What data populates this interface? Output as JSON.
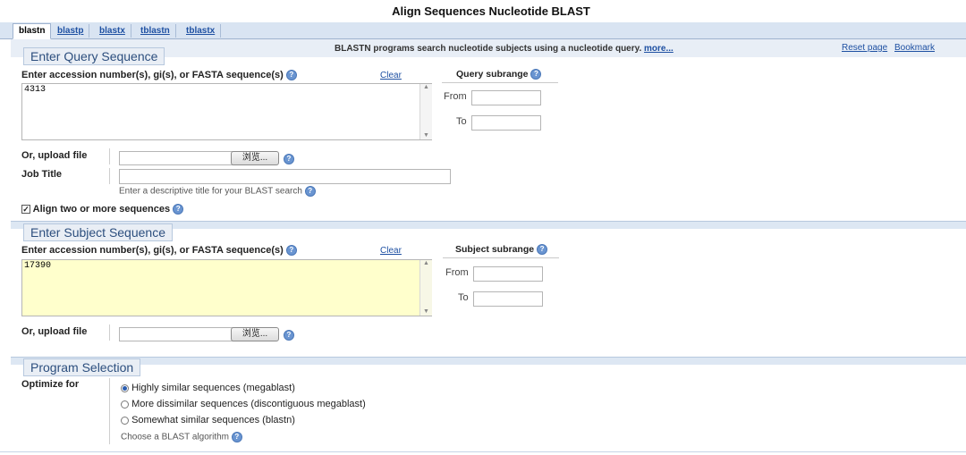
{
  "page_title": "Align Sequences Nucleotide BLAST",
  "tabs": [
    {
      "label": "blastn",
      "active": true
    },
    {
      "label": "blastp"
    },
    {
      "label": "blastx"
    },
    {
      "label": "tblastn"
    },
    {
      "label": "tblastx"
    }
  ],
  "header_bar": {
    "description": "BLASTN programs search nucleotide subjects using a nucleotide query.",
    "more_link": "more...",
    "reset_page": "Reset page",
    "bookmark": "Bookmark"
  },
  "query": {
    "legend": "Enter Query Sequence",
    "accession_label": "Enter accession number(s), gi(s), or FASTA sequence(s)",
    "clear": "Clear",
    "value": "4313",
    "subrange_label": "Query subrange",
    "from_label": "From",
    "to_label": "To",
    "upload_label": "Or, upload file",
    "browse": "浏览...",
    "job_title_label": "Job Title",
    "job_title_hint": "Enter a descriptive title for your BLAST search",
    "align_label": "Align two or more sequences",
    "align_checked": true
  },
  "subject": {
    "legend": "Enter Subject Sequence",
    "accession_label": "Enter accession number(s), gi(s), or FASTA sequence(s)",
    "clear": "Clear",
    "value": "17390",
    "subrange_label": "Subject subrange",
    "from_label": "From",
    "to_label": "To",
    "upload_label": "Or, upload file",
    "browse": "浏览..."
  },
  "program": {
    "legend": "Program Selection",
    "optimize_label": "Optimize for",
    "options": [
      {
        "label": "Highly similar sequences (megablast)",
        "selected": true
      },
      {
        "label": "More dissimilar sequences (discontiguous megablast)"
      },
      {
        "label": "Somewhat similar sequences (blastn)"
      }
    ],
    "hint": "Choose a BLAST algorithm"
  },
  "icons": {
    "help": "help-icon",
    "checkbox": "checkbox-icon",
    "radio": "radio-icon",
    "scroll_up": "scroll-up-arrow-icon",
    "scroll_down": "scroll-down-arrow-icon"
  },
  "colors": {
    "accent": "#1e50a2",
    "band": "#dde7f3",
    "subject_textarea_bg": "#ffffcc"
  }
}
